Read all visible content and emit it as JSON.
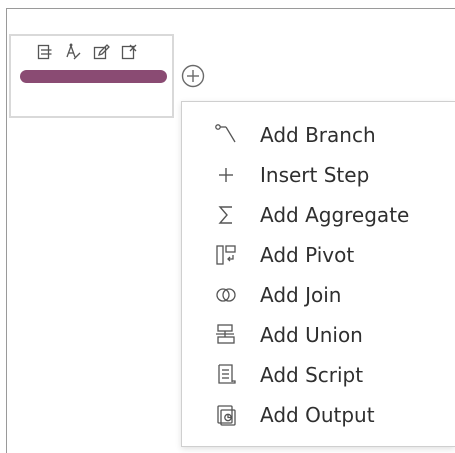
{
  "flow_step": {
    "toolbar_icons": [
      "filter-icon",
      "rename-icon",
      "edit-icon",
      "remove-icon"
    ],
    "bar_color": "#8a4b73"
  },
  "add_button": {
    "icon": "plus-circle-icon"
  },
  "menu": {
    "items": [
      {
        "label": "Add Branch",
        "icon": "branch-icon"
      },
      {
        "label": "Insert Step",
        "icon": "plus-icon"
      },
      {
        "label": "Add Aggregate",
        "icon": "sigma-icon"
      },
      {
        "label": "Add Pivot",
        "icon": "pivot-icon"
      },
      {
        "label": "Add Join",
        "icon": "join-icon"
      },
      {
        "label": "Add Union",
        "icon": "union-icon"
      },
      {
        "label": "Add Script",
        "icon": "script-icon"
      },
      {
        "label": "Add Output",
        "icon": "output-icon"
      }
    ]
  }
}
